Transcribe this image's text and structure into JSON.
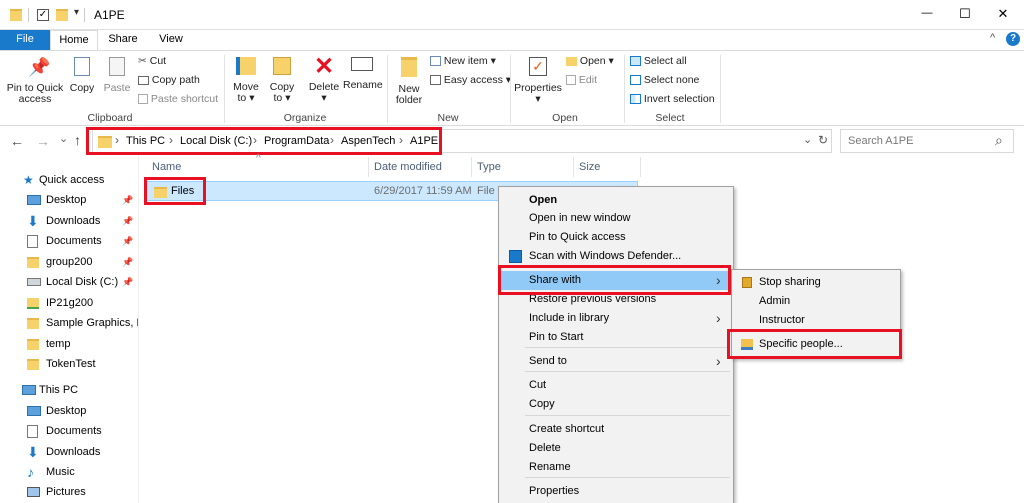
{
  "window": {
    "title": "A1PE"
  },
  "qat": {
    "dropdown_glyph": "▾"
  },
  "window_controls": {
    "minimize": "—",
    "maximize": "☐",
    "close": "✕"
  },
  "tabs": [
    {
      "label": "File",
      "active": false,
      "accent": true
    },
    {
      "label": "Home",
      "active": true
    },
    {
      "label": "Share",
      "active": false
    },
    {
      "label": "View",
      "active": false
    }
  ],
  "ribbon_toggle": "^",
  "help_icon": "?",
  "ribbon": {
    "clipboard": {
      "label": "Clipboard",
      "pin_line1": "Pin to Quick",
      "pin_line2": "access",
      "copy": "Copy",
      "paste": "Paste",
      "cut": "Cut",
      "copy_path": "Copy path",
      "paste_shortcut": "Paste shortcut"
    },
    "organize": {
      "label": "Organize",
      "move_line1": "Move",
      "move_line2": "to ▾",
      "copy_line1": "Copy",
      "copy_line2": "to ▾",
      "delete_line1": "Delete",
      "delete_line2": "▾",
      "rename": "Rename"
    },
    "new": {
      "label": "New",
      "folder_line1": "New",
      "folder_line2": "folder",
      "new_item": "New item ▾",
      "easy_access": "Easy access ▾"
    },
    "open": {
      "label": "Open",
      "properties_line1": "Properties",
      "properties_line2": "▾",
      "open": "Open ▾",
      "edit": "Edit"
    },
    "select": {
      "label": "Select",
      "select_all": "Select all",
      "select_none": "Select none",
      "invert": "Invert selection"
    }
  },
  "address": {
    "back": "←",
    "forward": "→",
    "recent": "⌄",
    "up": "↑",
    "crumbs": [
      "This PC",
      "Local Disk (C:)",
      "ProgramData",
      "AspenTech",
      "A1PE"
    ],
    "sep": "›",
    "dropdown": "⌄",
    "refresh": "↻",
    "search_placeholder": "Search A1PE",
    "search_icon": "⌕"
  },
  "nav": {
    "quick_access": "Quick access",
    "quick_items": [
      {
        "label": "Desktop",
        "icon": "desktop-icon",
        "pinned": true
      },
      {
        "label": "Downloads",
        "icon": "download-icon",
        "pinned": true
      },
      {
        "label": "Documents",
        "icon": "documents-icon",
        "pinned": true
      },
      {
        "label": "group200",
        "icon": "folder-icon",
        "pinned": true
      },
      {
        "label": "Local Disk (C:)",
        "icon": "drive-icon",
        "pinned": true
      },
      {
        "label": "IP21g200",
        "icon": "network-folder-icon",
        "pinned": false
      },
      {
        "label": "Sample Graphics, Pl",
        "icon": "folder-icon",
        "pinned": false
      },
      {
        "label": "temp",
        "icon": "folder-icon",
        "pinned": false
      },
      {
        "label": "TokenTest",
        "icon": "folder-icon",
        "pinned": false
      }
    ],
    "this_pc": "This PC",
    "pc_items": [
      {
        "label": "Desktop",
        "icon": "desktop-icon"
      },
      {
        "label": "Documents",
        "icon": "documents-icon"
      },
      {
        "label": "Downloads",
        "icon": "download-icon"
      },
      {
        "label": "Music",
        "icon": "music-icon"
      },
      {
        "label": "Pictures",
        "icon": "pictures-icon"
      }
    ],
    "pin_glyph": "📌"
  },
  "columns": {
    "name": "Name",
    "date": "Date modified",
    "type": "Type",
    "size": "Size",
    "sort_glyph": "^"
  },
  "files": [
    {
      "name": "Files",
      "date": "6/29/2017 11:59 AM",
      "type": "File f"
    }
  ],
  "context_menu": {
    "items": [
      "Open",
      "Open in new window",
      "Pin to Quick access",
      "Scan with Windows Defender...",
      "Share with",
      "Restore previous versions",
      "Include in library",
      "Pin to Start",
      "Send to",
      "Cut",
      "Copy",
      "Create shortcut",
      "Delete",
      "Rename",
      "Properties"
    ],
    "arrow": "›"
  },
  "share_menu": {
    "items": [
      "Stop sharing",
      "Admin",
      "Instructor",
      "Specific people..."
    ]
  },
  "colors": {
    "accent": "#1979ca",
    "highlight_red": "#e81123",
    "selected_row": "#cce8ff",
    "menu_hover": "#91c9f7"
  }
}
